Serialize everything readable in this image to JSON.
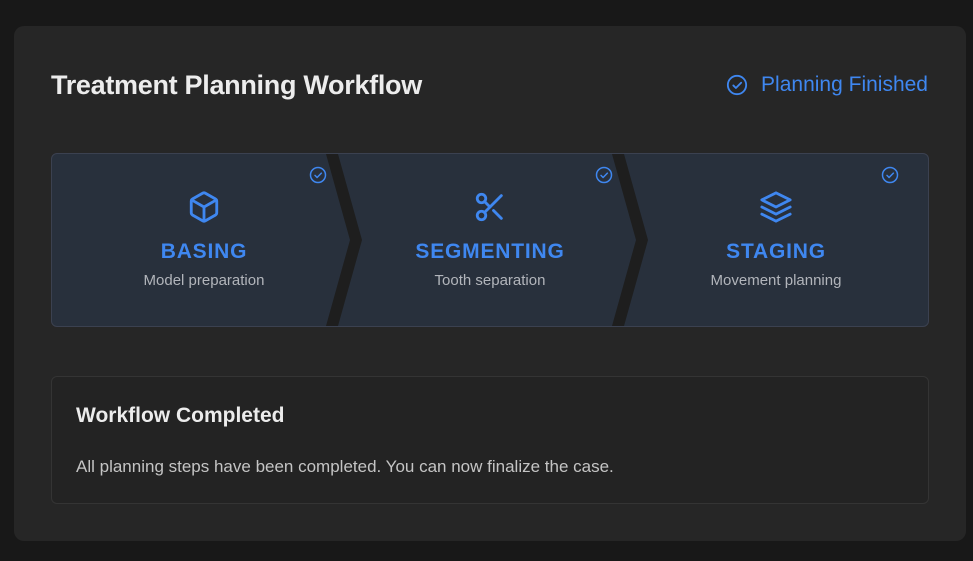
{
  "header": {
    "title": "Treatment Planning Workflow",
    "status_label": "Planning Finished",
    "status_icon": "check-circle-icon"
  },
  "colors": {
    "accent": "#3f87f0",
    "panel": "#262626",
    "background": "#181818",
    "steps_background": "#28303c"
  },
  "steps": [
    {
      "name": "BASING",
      "description": "Model preparation",
      "icon": "cube-icon",
      "completed": true
    },
    {
      "name": "SEGMENTING",
      "description": "Tooth separation",
      "icon": "scissors-icon",
      "completed": true
    },
    {
      "name": "STAGING",
      "description": "Movement planning",
      "icon": "layers-icon",
      "completed": true
    }
  ],
  "completion": {
    "title": "Workflow Completed",
    "message": "All planning steps have been completed. You can now finalize the case."
  }
}
